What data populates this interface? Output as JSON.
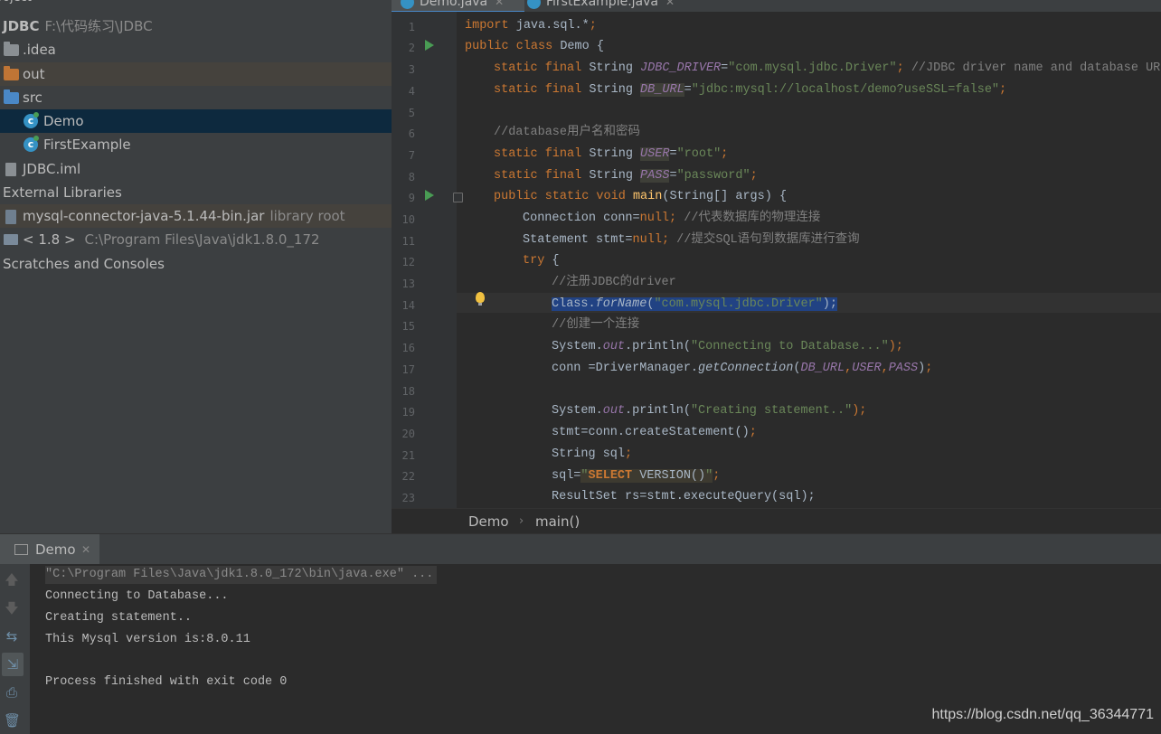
{
  "project_panel": {
    "title": "roject",
    "tree": [
      {
        "label": "JDBC",
        "hint": "F:\\代码练习\\JDBC",
        "icon": "module"
      },
      {
        "label": ".idea",
        "icon": "folder-icon"
      },
      {
        "label": "out",
        "icon": "folder-icon",
        "color": "#c07535"
      },
      {
        "label": "src",
        "icon": "folder-icon",
        "color": "#4a88c7"
      },
      {
        "label": "Demo",
        "icon": "java-class-icon"
      },
      {
        "label": "FirstExample",
        "icon": "java-class-icon"
      },
      {
        "label": "JDBC.iml",
        "icon": "iml-file-icon"
      },
      {
        "label": "External Libraries",
        "icon": "library-icon"
      },
      {
        "label": "mysql-connector-java-5.1.44-bin.jar",
        "hint": "library root",
        "icon": "jar-icon"
      },
      {
        "label": "< 1.8 >",
        "hint": "C:\\Program Files\\Java\\jdk1.8.0_172",
        "icon": "jdk-icon"
      },
      {
        "label": "Scratches and Consoles",
        "icon": "scratches-icon"
      }
    ]
  },
  "editor": {
    "tabs": [
      {
        "label": "Demo.java",
        "active": true
      },
      {
        "label": "FirstExample.java",
        "active": false
      }
    ],
    "lines": [
      "1",
      "2",
      "3",
      "4",
      "5",
      "6",
      "7",
      "8",
      "9",
      "10",
      "11",
      "12",
      "13",
      "14",
      "15",
      "16",
      "17",
      "18",
      "19",
      "20",
      "21",
      "22",
      "23"
    ],
    "code": {
      "l1a": "import ",
      "l1b": "java.sql.*",
      "l1c": ";",
      "l2a": "public class ",
      "l2b": "Demo {",
      "l3a": "static final ",
      "l3b": "String ",
      "l3c": "JDBC_DRIVER",
      "l3d": "=",
      "l3e": "\"com.mysql.jdbc.Driver\"",
      "l3f": "; ",
      "l3g": "//JDBC driver name and database URL",
      "l4a": "static final ",
      "l4b": "String ",
      "l4c": "DB_URL",
      "l4d": "=",
      "l4e": "\"jdbc:mysql://localhost/demo?useSSL=false\"",
      "l4f": ";",
      "l6": "//database用户名和密码",
      "l7a": "static final ",
      "l7b": "String ",
      "l7c": "USER",
      "l7d": "=",
      "l7e": "\"root\"",
      "l7f": ";",
      "l8a": "static final ",
      "l8b": "String ",
      "l8c": "PASS",
      "l8d": "=",
      "l8e": "\"password\"",
      "l8f": ";",
      "l9a": "public static void ",
      "l9b": "main",
      "l9c": "(String[] args) {",
      "l10a": "Connection conn=",
      "l10b": "null",
      "l10c": "; ",
      "l10d": "//代表数据库的物理连接",
      "l11a": "Statement stmt=",
      "l11b": "null",
      "l11c": "; ",
      "l11d": "//提交SQL语句到数据库进行查询",
      "l12a": "try ",
      "l12b": "{",
      "l13": "//注册JDBC的driver",
      "l14a": "Class.",
      "l14b": "forName",
      "l14c": "(",
      "l14d": "\"com.mysql.jdbc.Driver\"",
      "l14e": ");",
      "l15": "//创建一个连接",
      "l16a": "System.",
      "l16b": "out",
      "l16c": ".println(",
      "l16d": "\"Connecting to Database...\"",
      "l16e": ");",
      "l17a": "conn =DriverManager.",
      "l17b": "getConnection",
      "l17c": "(",
      "l17d": "DB_URL",
      "l17e": ",",
      "l17f": "USER",
      "l17g": ",",
      "l17h": "PASS",
      "l17i": ")",
      "l17j": ";",
      "l19a": "System.",
      "l19b": "out",
      "l19c": ".println(",
      "l19d": "\"Creating statement..\"",
      "l19e": ");",
      "l20a": "stmt=conn.createStatement()",
      "l20b": ";",
      "l21a": "String sql",
      "l21b": ";",
      "l22a": "sql=",
      "l22b": "\"",
      "l22c": "SELECT",
      "l22d": " VERSION()",
      "l22e": "\"",
      "l22f": ";",
      "l23": "ResultSet rs=stmt.executeQuery(sql);"
    },
    "breadcrumb": {
      "class": "Demo",
      "method": "main()",
      "separator": "›"
    }
  },
  "run_panel": {
    "tab_label": "Demo",
    "console": [
      "\"C:\\Program Files\\Java\\jdk1.8.0_172\\bin\\java.exe\" ...",
      "Connecting to Database...",
      "Creating statement..",
      "This Mysql version is:8.0.11",
      "",
      "Process finished with exit code 0"
    ]
  },
  "watermark": "https://blog.csdn.net/qq_36344771"
}
